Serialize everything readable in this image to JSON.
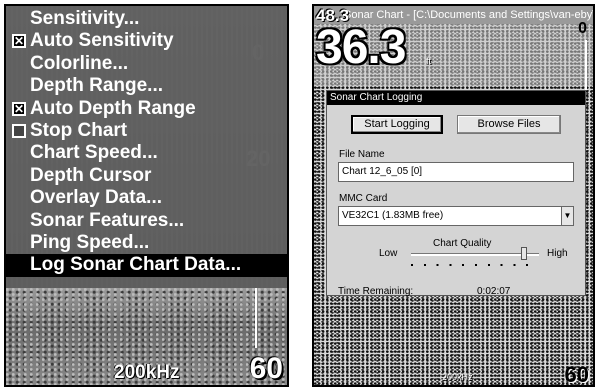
{
  "left": {
    "menu": [
      {
        "label": "Sensitivity...",
        "check": null,
        "selected": false
      },
      {
        "label": "Auto Sensitivity",
        "check": true,
        "selected": false
      },
      {
        "label": "Colorline...",
        "check": null,
        "selected": false
      },
      {
        "label": "Depth Range...",
        "check": null,
        "selected": false
      },
      {
        "label": "Auto Depth Range",
        "check": true,
        "selected": false
      },
      {
        "label": "Stop Chart",
        "check": false,
        "selected": false
      },
      {
        "label": "Chart Speed...",
        "check": null,
        "selected": false
      },
      {
        "label": "Depth Cursor",
        "check": null,
        "selected": false
      },
      {
        "label": "Overlay Data...",
        "check": null,
        "selected": false
      },
      {
        "label": "Sonar Features...",
        "check": null,
        "selected": false
      },
      {
        "label": "Ping Speed...",
        "check": null,
        "selected": false
      },
      {
        "label": "Log Sonar Chart Data...",
        "check": null,
        "selected": true
      }
    ],
    "scale_mark": "20",
    "scale_zero": "0",
    "frequency": "200kHz",
    "depth_scale": "60"
  },
  "right": {
    "titlebar": "Sonar Chart - [C:\\Documents and Settings\\van-eby\\M...",
    "small_depth": "48.3",
    "big_depth": "36.3",
    "unit": "ft",
    "scale_top": "0",
    "frequency": "200kHz",
    "scale_bottom": "60",
    "dialog": {
      "title": "Sonar Chart Logging",
      "start_button": "Start Logging",
      "browse_button": "Browse Files",
      "file_name_label": "File Name",
      "file_name_value": "Chart 12_6_05 [0]",
      "mmc_label": "MMC Card",
      "mmc_value": "VE32C1 (1.83MB free)",
      "quality_title": "Chart Quality",
      "quality_low": "Low",
      "quality_high": "High",
      "quality_level": 0.88,
      "time_label": "Time Remaining:",
      "time_value": "0:02:07"
    }
  }
}
